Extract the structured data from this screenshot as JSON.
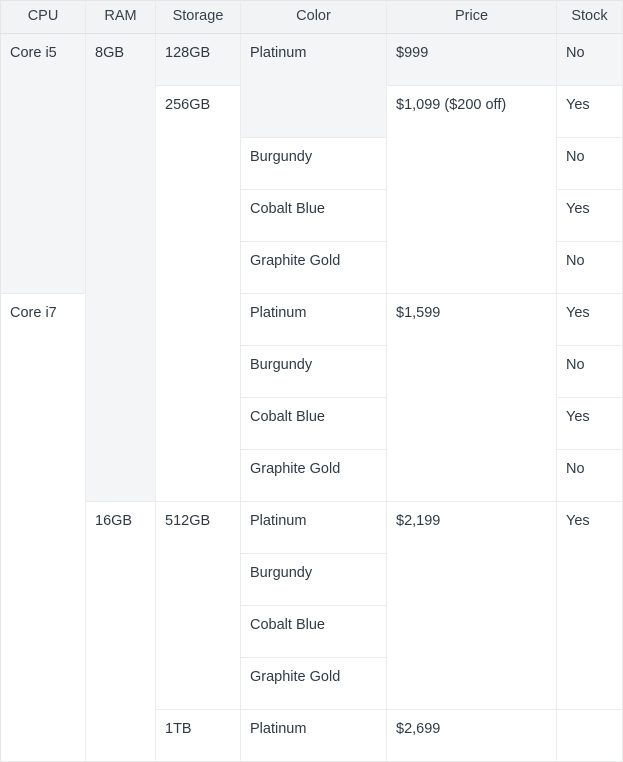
{
  "table": {
    "name": "product-configuration-table",
    "columns": [
      {
        "key": "cpu",
        "label": "CPU"
      },
      {
        "key": "ram",
        "label": "RAM"
      },
      {
        "key": "storage",
        "label": "Storage"
      },
      {
        "key": "color",
        "label": "Color"
      },
      {
        "key": "price",
        "label": "Price"
      },
      {
        "key": "stock",
        "label": "Stock"
      }
    ],
    "colors": {
      "header_background": "#f2f3f4",
      "shaded_row_background": "#f4f5f6",
      "row_background": "#ffffff",
      "border": "#e9ebed",
      "text": "#303a45"
    },
    "cells": {
      "cpu_core_i5": "Core i5",
      "cpu_core_i7": "Core i7",
      "ram_8gb": "8GB",
      "ram_16gb": "16GB",
      "storage_128gb": "128GB",
      "storage_256gb": "256GB",
      "storage_512gb": "512GB",
      "storage_1tb": "1TB",
      "color_platinum": "Platinum",
      "color_burgundy": "Burgundy",
      "color_cobalt_blue": "Cobalt Blue",
      "color_graphite_gold": "Graphite Gold",
      "price_999": "$999",
      "price_1099": "$1,099 ($200 off)",
      "price_1599": "$1,599",
      "price_2199": "$2,199",
      "price_2699": "$2,699",
      "stock_yes": "Yes",
      "stock_no": "No",
      "stock_empty": ""
    },
    "rows": [
      {
        "row_index": 1,
        "shaded": true,
        "cpu": "Core i5",
        "ram": "8GB",
        "storage": "128GB",
        "color": "Platinum",
        "price": "$999",
        "stock": "No"
      },
      {
        "row_index": 2,
        "shaded": false,
        "cpu": "Core i5",
        "ram": "8GB",
        "storage": "256GB",
        "color": "Platinum",
        "price": "$1,099 ($200 off)",
        "stock": "Yes"
      },
      {
        "row_index": 3,
        "shaded": false,
        "cpu": "Core i5",
        "ram": "8GB",
        "storage": "256GB",
        "color": "Burgundy",
        "price": "$1,099 ($200 off)",
        "stock": "No"
      },
      {
        "row_index": 4,
        "shaded": false,
        "cpu": "Core i5",
        "ram": "8GB",
        "storage": "256GB",
        "color": "Cobalt Blue",
        "price": "$1,099 ($200 off)",
        "stock": "Yes"
      },
      {
        "row_index": 5,
        "shaded": false,
        "cpu": "Core i5",
        "ram": "8GB",
        "storage": "256GB",
        "color": "Graphite Gold",
        "price": "$1,099 ($200 off)",
        "stock": "No"
      },
      {
        "row_index": 6,
        "shaded": false,
        "cpu": "Core i7",
        "ram": "8GB",
        "storage": "256GB",
        "color": "Platinum",
        "price": "$1,599",
        "stock": "Yes"
      },
      {
        "row_index": 7,
        "shaded": false,
        "cpu": "Core i7",
        "ram": "8GB",
        "storage": "256GB",
        "color": "Burgundy",
        "price": "$1,599",
        "stock": "No"
      },
      {
        "row_index": 8,
        "shaded": false,
        "cpu": "Core i7",
        "ram": "8GB",
        "storage": "256GB",
        "color": "Cobalt Blue",
        "price": "$1,599",
        "stock": "Yes"
      },
      {
        "row_index": 9,
        "shaded": false,
        "cpu": "Core i7",
        "ram": "8GB",
        "storage": "256GB",
        "color": "Graphite Gold",
        "price": "$1,599",
        "stock": "No"
      },
      {
        "row_index": 10,
        "shaded": false,
        "cpu": "Core i7",
        "ram": "16GB",
        "storage": "512GB",
        "color": "Platinum",
        "price": "$2,199",
        "stock": "Yes"
      },
      {
        "row_index": 11,
        "shaded": false,
        "cpu": "Core i7",
        "ram": "16GB",
        "storage": "512GB",
        "color": "Burgundy",
        "price": "$2,199",
        "stock": "Yes"
      },
      {
        "row_index": 12,
        "shaded": false,
        "cpu": "Core i7",
        "ram": "16GB",
        "storage": "512GB",
        "color": "Cobalt Blue",
        "price": "$2,199",
        "stock": "Yes"
      },
      {
        "row_index": 13,
        "shaded": false,
        "cpu": "Core i7",
        "ram": "16GB",
        "storage": "512GB",
        "color": "Graphite Gold",
        "price": "$2,199",
        "stock": "Yes"
      },
      {
        "row_index": 14,
        "shaded": false,
        "cpu": "Core i7",
        "ram": "16GB",
        "storage": "1TB",
        "color": "Platinum",
        "price": "$2,699",
        "stock": ""
      }
    ]
  }
}
